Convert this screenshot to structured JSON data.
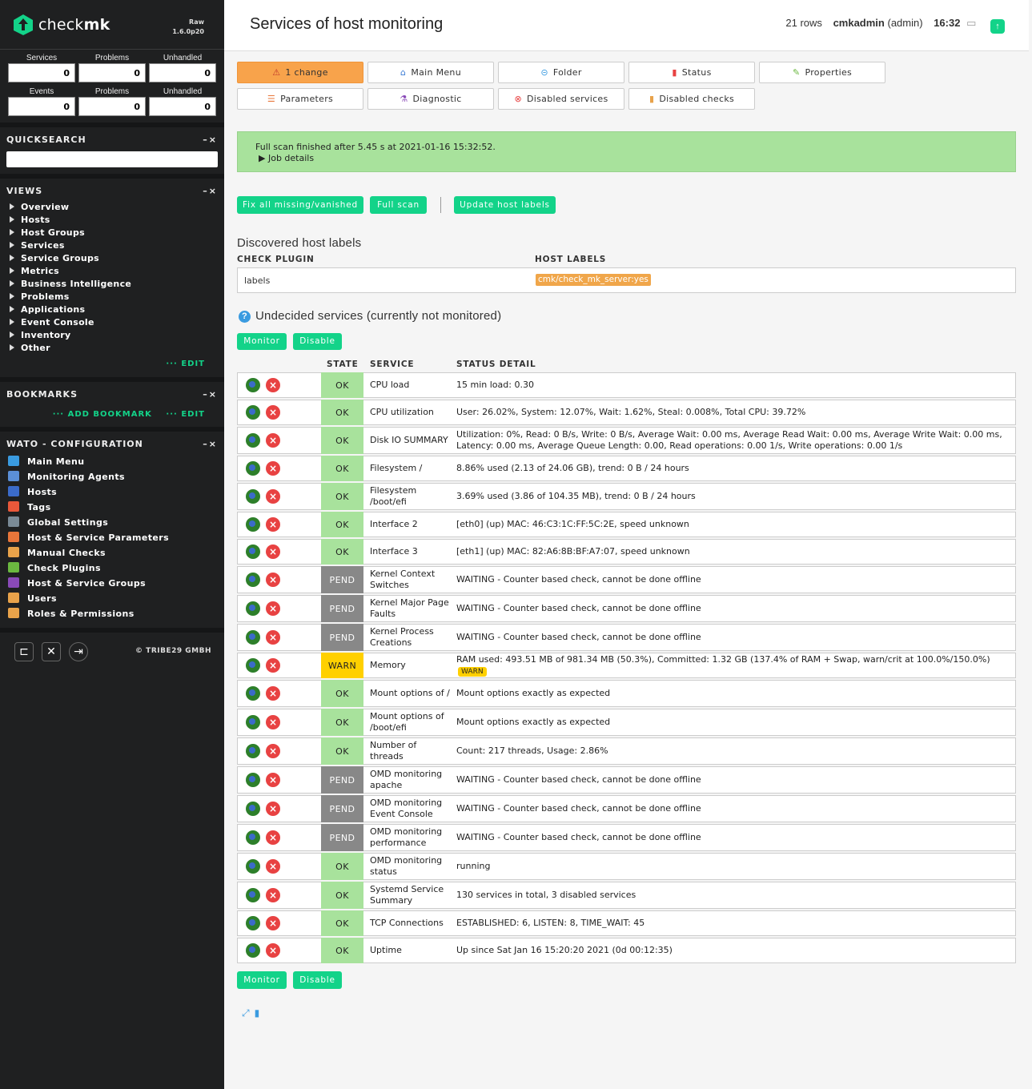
{
  "sidebar": {
    "logo_text_light": "check",
    "logo_text_bold": "mk",
    "edition": "Raw",
    "version": "1.6.0p20",
    "counts": {
      "row1_labels": [
        "Services",
        "Problems",
        "Unhandled"
      ],
      "row1_values": [
        "0",
        "0",
        "0"
      ],
      "row2_labels": [
        "Events",
        "Problems",
        "Unhandled"
      ],
      "row2_values": [
        "0",
        "0",
        "0"
      ]
    },
    "quicksearch_title": "QUICKSEARCH",
    "views_title": "VIEWS",
    "views": [
      "Overview",
      "Hosts",
      "Host Groups",
      "Services",
      "Service Groups",
      "Metrics",
      "Business Intelligence",
      "Problems",
      "Applications",
      "Event Console",
      "Inventory",
      "Other"
    ],
    "edit_label": "EDIT",
    "bookmarks_title": "BOOKMARKS",
    "add_bookmark_label": "ADD BOOKMARK",
    "wato_title": "WATO - CONFIGURATION",
    "wato_items": [
      {
        "label": "Main Menu",
        "icon": "main-menu-icon",
        "color": "#3a9be0"
      },
      {
        "label": "Monitoring Agents",
        "icon": "agents-icon",
        "color": "#5b8fd6"
      },
      {
        "label": "Hosts",
        "icon": "hosts-icon",
        "color": "#3b6bc9"
      },
      {
        "label": "Tags",
        "icon": "tags-icon",
        "color": "#e8583a"
      },
      {
        "label": "Global Settings",
        "icon": "global-settings-icon",
        "color": "#7a8a96"
      },
      {
        "label": "Host & Service Parameters",
        "icon": "parameters-icon",
        "color": "#e8763a"
      },
      {
        "label": "Manual Checks",
        "icon": "manual-checks-icon",
        "color": "#e8a24a"
      },
      {
        "label": "Check Plugins",
        "icon": "check-plugins-icon",
        "color": "#6bb840"
      },
      {
        "label": "Host & Service Groups",
        "icon": "groups-icon",
        "color": "#8a4ab8"
      },
      {
        "label": "Users",
        "icon": "users-icon",
        "color": "#e8a24a"
      },
      {
        "label": "Roles & Permissions",
        "icon": "roles-icon",
        "color": "#e8a24a"
      }
    ],
    "copyright": "© TRIBE29 GMBH"
  },
  "header": {
    "title": "Services of host monitoring",
    "rows": "21 rows",
    "user": "cmkadmin",
    "role": "(admin)",
    "time": "16:32"
  },
  "toolbar": {
    "buttons": [
      {
        "label": "1 change",
        "icon": "warning-icon"
      },
      {
        "label": "Main Menu",
        "icon": "home-icon"
      },
      {
        "label": "Folder",
        "icon": "back-icon"
      },
      {
        "label": "Status",
        "icon": "traffic-light-icon"
      },
      {
        "label": "Properties",
        "icon": "pencil-icon"
      },
      {
        "label": "Parameters",
        "icon": "parameters-icon"
      },
      {
        "label": "Diagnostic",
        "icon": "flask-icon"
      },
      {
        "label": "Disabled services",
        "icon": "disabled-icon"
      },
      {
        "label": "Disabled checks",
        "icon": "bar-chart-icon"
      }
    ]
  },
  "message": {
    "text": "Full scan finished after 5.45 s at 2021-01-16 15:32:52.",
    "details": "Job details"
  },
  "actions": {
    "fix_all": "Fix all missing/vanished",
    "full_scan": "Full scan",
    "update_labels": "Update host labels"
  },
  "labels_section": {
    "title": "Discovered host labels",
    "col_plugin": "CHECK PLUGIN",
    "col_labels": "HOST LABELS",
    "plugin": "labels",
    "label": "cmk/check_mk_server:yes"
  },
  "undecided": {
    "title": "Undecided services (currently not monitored)",
    "monitor": "Monitor",
    "disable": "Disable",
    "col_state": "STATE",
    "col_service": "SERVICE",
    "col_detail": "STATUS DETAIL"
  },
  "services": [
    {
      "state": "OK",
      "service": "CPU load",
      "detail": "15 min load: 0.30"
    },
    {
      "state": "OK",
      "service": "CPU utilization",
      "detail": "User: 26.02%, System: 12.07%, Wait: 1.62%, Steal: 0.008%, Total CPU: 39.72%"
    },
    {
      "state": "OK",
      "service": "Disk IO SUMMARY",
      "detail": "Utilization: 0%, Read: 0 B/s, Write: 0 B/s, Average Wait: 0.00 ms, Average Read Wait: 0.00 ms, Average Write Wait: 0.00 ms, Latency: 0.00 ms, Average Queue Length: 0.00, Read operations: 0.00 1/s, Write operations: 0.00 1/s"
    },
    {
      "state": "OK",
      "service": "Filesystem /",
      "detail": "8.86% used (2.13 of 24.06 GB), trend: 0 B / 24 hours"
    },
    {
      "state": "OK",
      "service": "Filesystem /boot/efi",
      "detail": "3.69% used (3.86 of 104.35 MB), trend: 0 B / 24 hours"
    },
    {
      "state": "OK",
      "service": "Interface 2",
      "detail": "[eth0] (up) MAC: 46:C3:1C:FF:5C:2E, speed unknown"
    },
    {
      "state": "OK",
      "service": "Interface 3",
      "detail": "[eth1] (up) MAC: 82:A6:8B:BF:A7:07, speed unknown"
    },
    {
      "state": "PEND",
      "service": "Kernel Context Switches",
      "detail": "WAITING - Counter based check, cannot be done offline"
    },
    {
      "state": "PEND",
      "service": "Kernel Major Page Faults",
      "detail": "WAITING - Counter based check, cannot be done offline"
    },
    {
      "state": "PEND",
      "service": "Kernel Process Creations",
      "detail": "WAITING - Counter based check, cannot be done offline"
    },
    {
      "state": "WARN",
      "service": "Memory",
      "detail": "RAM used: 493.51 MB of 981.34 MB (50.3%), Committed: 1.32 GB (137.4% of RAM + Swap, warn/crit at 100.0%/150.0%)",
      "badge": "WARN"
    },
    {
      "state": "OK",
      "service": "Mount options of /",
      "detail": "Mount options exactly as expected"
    },
    {
      "state": "OK",
      "service": "Mount options of /boot/efi",
      "detail": "Mount options exactly as expected"
    },
    {
      "state": "OK",
      "service": "Number of threads",
      "detail": "Count: 217 threads, Usage: 2.86%"
    },
    {
      "state": "PEND",
      "service": "OMD monitoring apache",
      "detail": "WAITING - Counter based check, cannot be done offline"
    },
    {
      "state": "PEND",
      "service": "OMD monitoring Event Console",
      "detail": "WAITING - Counter based check, cannot be done offline"
    },
    {
      "state": "PEND",
      "service": "OMD monitoring performance",
      "detail": "WAITING - Counter based check, cannot be done offline"
    },
    {
      "state": "OK",
      "service": "OMD monitoring status",
      "detail": "running"
    },
    {
      "state": "OK",
      "service": "Systemd Service Summary",
      "detail": "130 services in total, 3 disabled services"
    },
    {
      "state": "OK",
      "service": "TCP Connections",
      "detail": "ESTABLISHED: 6, LISTEN: 8, TIME_WAIT: 45"
    },
    {
      "state": "OK",
      "service": "Uptime",
      "detail": "Up since Sat Jan 16 15:20:20 2021 (0d 00:12:35)"
    }
  ],
  "colors": {
    "accent": "#13d389",
    "ok": "#a8e29c",
    "pend": "#888888",
    "warn": "#ffd000",
    "sidebar": "#1f2021"
  }
}
